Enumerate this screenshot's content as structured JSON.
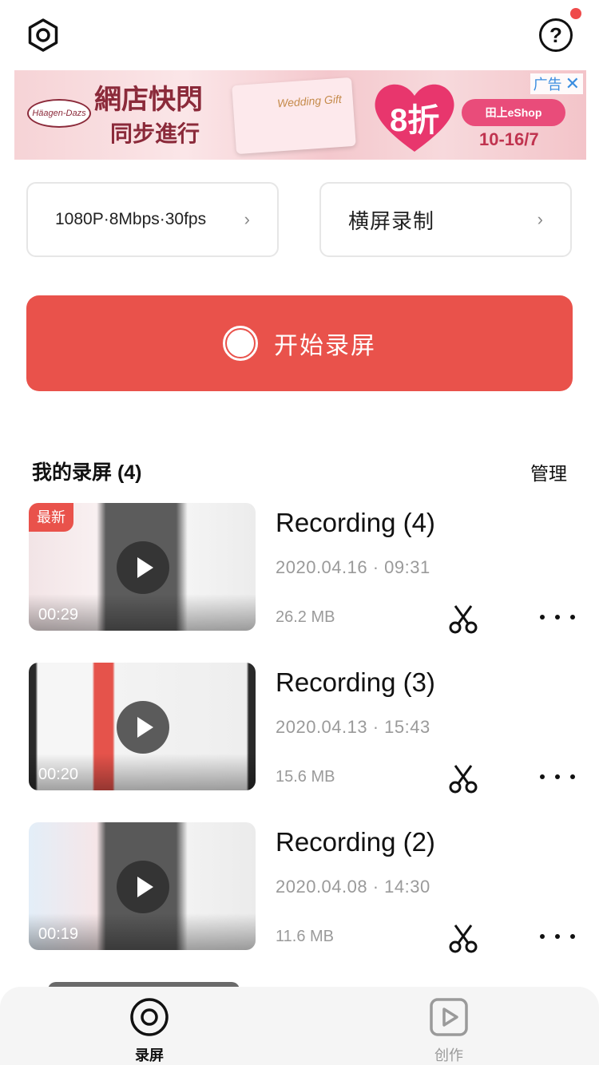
{
  "topbar": {
    "settings_icon": "settings-hexagon-icon",
    "help_icon": "help-icon",
    "help_glyph": "?",
    "notification_color": "#ef4b4b"
  },
  "ad": {
    "headline": "網店快閃",
    "subline": "同步進行",
    "brand": "Häagen-Dazs",
    "card_text": "Wedding Gift",
    "discount": "8折",
    "shop": "田上eShop",
    "date": "10-16/7",
    "tag": "广告",
    "close": "✕"
  },
  "options": {
    "quality": "1080P·8Mbps·30fps",
    "orientation": "横屏录制",
    "chevron": "›"
  },
  "record_button": {
    "label": "开始录屏",
    "color": "#e9524b"
  },
  "section": {
    "title": "我的录屏 (4)",
    "manage": "管理"
  },
  "recordings": [
    {
      "title": "Recording (4)",
      "date": "2020.04.16 · 09:31",
      "size": "26.2 MB",
      "duration": "00:29",
      "badge": "最新"
    },
    {
      "title": "Recording (3)",
      "date": "2020.04.13 · 15:43",
      "size": "15.6 MB",
      "duration": "00:20"
    },
    {
      "title": "Recording (2)",
      "date": "2020.04.08 · 14:30",
      "size": "11.6 MB",
      "duration": "00:19"
    }
  ],
  "tabbar": {
    "record_label": "录屏",
    "create_label": "创作"
  }
}
